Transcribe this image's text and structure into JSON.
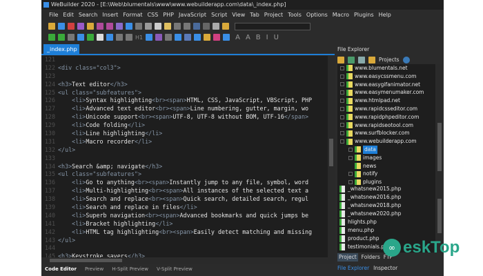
{
  "window": {
    "title": "WeBuilder 2020 - [E:\\Web\\blumentals\\www\\www.webuilderapp.com\\data\\_index.php]"
  },
  "menu": [
    "File",
    "Edit",
    "Search",
    "Insert",
    "Format",
    "CSS",
    "PHP",
    "JavaScript",
    "Script",
    "View",
    "Tab",
    "Project",
    "Tools",
    "Options",
    "Macro",
    "Plugins",
    "Help"
  ],
  "toolbar2_labels": {
    "heading": "H1",
    "font_a": "A",
    "bold": "B",
    "italic": "I",
    "underline": "U"
  },
  "editor_tab": {
    "label": "_index.php",
    "close": "×"
  },
  "code_lines": [
    {
      "n": "121",
      "seg": []
    },
    {
      "n": "122",
      "seg": [
        [
          "<div class=\"col3\">",
          "tag"
        ]
      ]
    },
    {
      "n": "123",
      "seg": []
    },
    {
      "n": "124",
      "seg": [
        [
          "<h3>",
          "tag"
        ],
        [
          "Text editor",
          "txt"
        ],
        [
          "</h3>",
          "tag"
        ]
      ]
    },
    {
      "n": "125",
      "seg": [
        [
          "<ul class=\"subfeatures\">",
          "tag"
        ]
      ]
    },
    {
      "n": "126",
      "seg": [
        [
          "    <li>",
          "tag"
        ],
        [
          "Syntax highlighting",
          "txt"
        ],
        [
          "<br><span>",
          "tag"
        ],
        [
          "HTML, CSS, JavaScript, VBScript, PHP",
          "txt"
        ]
      ]
    },
    {
      "n": "127",
      "seg": [
        [
          "    <li>",
          "tag"
        ],
        [
          "Advanced text editor",
          "txt"
        ],
        [
          "<br><span>",
          "tag"
        ],
        [
          "Line numbering, gutter, margin, wo",
          "txt"
        ]
      ]
    },
    {
      "n": "128",
      "seg": [
        [
          "    <li>",
          "tag"
        ],
        [
          "Unicode support",
          "txt"
        ],
        [
          "<br><span>",
          "tag"
        ],
        [
          "UTF-8, UTF-8 without BOM, UTF-16",
          "txt"
        ],
        [
          "</span>",
          "tag"
        ]
      ]
    },
    {
      "n": "129",
      "seg": [
        [
          "    <li>",
          "tag"
        ],
        [
          "Code folding",
          "txt"
        ],
        [
          "</li>",
          "tag"
        ]
      ]
    },
    {
      "n": "130",
      "seg": [
        [
          "    <li>",
          "tag"
        ],
        [
          "Line highlighting",
          "txt"
        ],
        [
          "</li>",
          "tag"
        ]
      ]
    },
    {
      "n": "131",
      "seg": [
        [
          "    <li>",
          "tag"
        ],
        [
          "Macro recorder",
          "txt"
        ],
        [
          "</li>",
          "tag"
        ]
      ]
    },
    {
      "n": "132",
      "seg": [
        [
          "</ul>",
          "tag"
        ]
      ]
    },
    {
      "n": "133",
      "seg": []
    },
    {
      "n": "134",
      "seg": [
        [
          "<h3>",
          "tag"
        ],
        [
          "Search &amp; navigate",
          "txt"
        ],
        [
          "</h3>",
          "tag"
        ]
      ]
    },
    {
      "n": "135",
      "seg": [
        [
          "<ul class=\"subfeatures\">",
          "tag"
        ]
      ]
    },
    {
      "n": "136",
      "seg": [
        [
          "    <li>",
          "tag"
        ],
        [
          "Go to anything",
          "txt"
        ],
        [
          "<br><span>",
          "tag"
        ],
        [
          "Instantly jump to any file, symbol, word",
          "txt"
        ]
      ]
    },
    {
      "n": "137",
      "seg": [
        [
          "    <li>",
          "tag"
        ],
        [
          "Multi-highlighting",
          "txt"
        ],
        [
          "<br><span>",
          "tag"
        ],
        [
          "All instances of the selected text a",
          "txt"
        ]
      ]
    },
    {
      "n": "138",
      "seg": [
        [
          "    <li>",
          "tag"
        ],
        [
          "Search and replace",
          "txt"
        ],
        [
          "<br><span>",
          "tag"
        ],
        [
          "Quick search, detailed search, regul",
          "txt"
        ]
      ]
    },
    {
      "n": "139",
      "seg": [
        [
          "    <li>",
          "tag"
        ],
        [
          "Search and replace in files",
          "txt"
        ],
        [
          "</li>",
          "tag"
        ]
      ]
    },
    {
      "n": "140",
      "seg": [
        [
          "    <li>",
          "tag"
        ],
        [
          "Superb navigation",
          "txt"
        ],
        [
          "<br><span>",
          "tag"
        ],
        [
          "Advanced bookmarks and quick jumps be",
          "txt"
        ]
      ]
    },
    {
      "n": "141",
      "seg": [
        [
          "    <li>",
          "tag"
        ],
        [
          "Bracket highlighting",
          "txt"
        ],
        [
          "</li>",
          "tag"
        ]
      ]
    },
    {
      "n": "142",
      "seg": [
        [
          "    <li>",
          "tag"
        ],
        [
          "HTML tag highlighting",
          "txt"
        ],
        [
          "<br><span>",
          "tag"
        ],
        [
          "Easily detect matching and missing",
          "txt"
        ]
      ]
    },
    {
      "n": "143",
      "seg": [
        [
          "</ul>",
          "tag"
        ]
      ]
    },
    {
      "n": "144",
      "seg": []
    },
    {
      "n": "145",
      "seg": [
        [
          "<h3>",
          "tag"
        ],
        [
          "Keystroke savers",
          "txt"
        ],
        [
          "</h3>",
          "tag"
        ]
      ]
    }
  ],
  "bottom_tabs": [
    "Code Editor",
    "Preview",
    "H-Split Preview",
    "V-Split Preview"
  ],
  "panel": {
    "title": "File Explorer",
    "projects_label": "Projects",
    "tree": [
      {
        "label": "www.blumentals.net",
        "level": 0,
        "expander": "+"
      },
      {
        "label": "www.easycssmenu.com",
        "level": 0,
        "expander": "+"
      },
      {
        "label": "www.easygifanimator.net",
        "level": 0,
        "expander": "+"
      },
      {
        "label": "www.easymenumaker.com",
        "level": 0,
        "expander": "+"
      },
      {
        "label": "www.htmlpad.net",
        "level": 0,
        "expander": "+"
      },
      {
        "label": "www.rapidcsseditor.com",
        "level": 0,
        "expander": "+"
      },
      {
        "label": "www.rapidphpeditor.com",
        "level": 0,
        "expander": "+"
      },
      {
        "label": "www.rapidseotool.com",
        "level": 0,
        "expander": "+"
      },
      {
        "label": "www.surfblocker.com",
        "level": 0,
        "expander": "+"
      },
      {
        "label": "www.webuilderapp.com",
        "level": 0,
        "expander": "-"
      },
      {
        "label": "data",
        "level": 1,
        "expander": "+",
        "selected": true
      },
      {
        "label": "images",
        "level": 1,
        "expander": "+"
      },
      {
        "label": "news",
        "level": 1,
        "expander": ""
      },
      {
        "label": "notify",
        "level": 1,
        "expander": "+"
      },
      {
        "label": "plugins",
        "level": 1,
        "expander": "+"
      }
    ],
    "files": [
      "_whatsnew2015.php",
      "_whatsnew2016.php",
      "_whatsnew2018.php",
      "_whatsnew2020.php",
      "hlights.php",
      "menu.php",
      "product.php",
      "testimonials.php"
    ],
    "tabs": [
      "Project",
      "Folders",
      "FTP"
    ],
    "bottom_tabs": [
      "File Explorer",
      "Inspector"
    ]
  },
  "watermark": {
    "text": "eskTop"
  },
  "colors": {
    "accent": "#1e7fd8",
    "editor_bg": "#1e1e1e",
    "watermark": "#2aa68a"
  }
}
